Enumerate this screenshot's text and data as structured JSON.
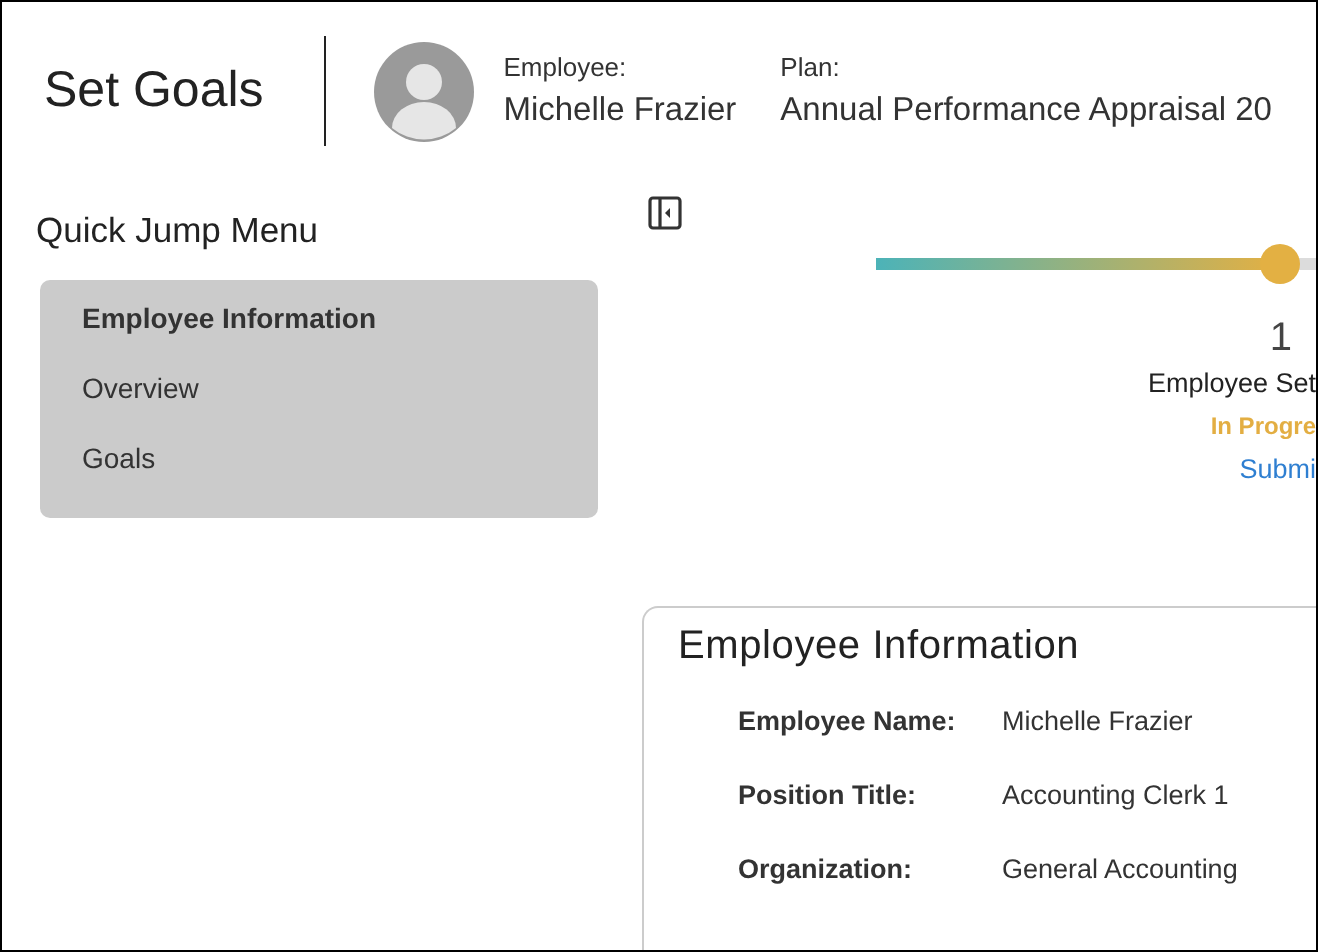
{
  "header": {
    "title": "Set Goals",
    "employee_label": "Employee:",
    "employee_name": "Michelle Frazier",
    "plan_label": "Plan:",
    "plan_name": "Annual Performance Appraisal 20"
  },
  "quick_jump": {
    "title": "Quick Jump Menu",
    "items": [
      {
        "label": "Employee Information",
        "selected": true
      },
      {
        "label": "Overview",
        "selected": false
      },
      {
        "label": "Goals",
        "selected": false
      }
    ]
  },
  "steps": [
    {
      "number": "1",
      "name": "Employee Set",
      "status": "In Progre",
      "action": "Submi"
    }
  ],
  "employee_info": {
    "title": "Employee Information",
    "fields": [
      {
        "label": "Employee Name:",
        "value": "Michelle Frazier"
      },
      {
        "label": "Position Title:",
        "value": "Accounting Clerk 1"
      },
      {
        "label": "Organization:",
        "value": "General Accounting"
      }
    ]
  }
}
